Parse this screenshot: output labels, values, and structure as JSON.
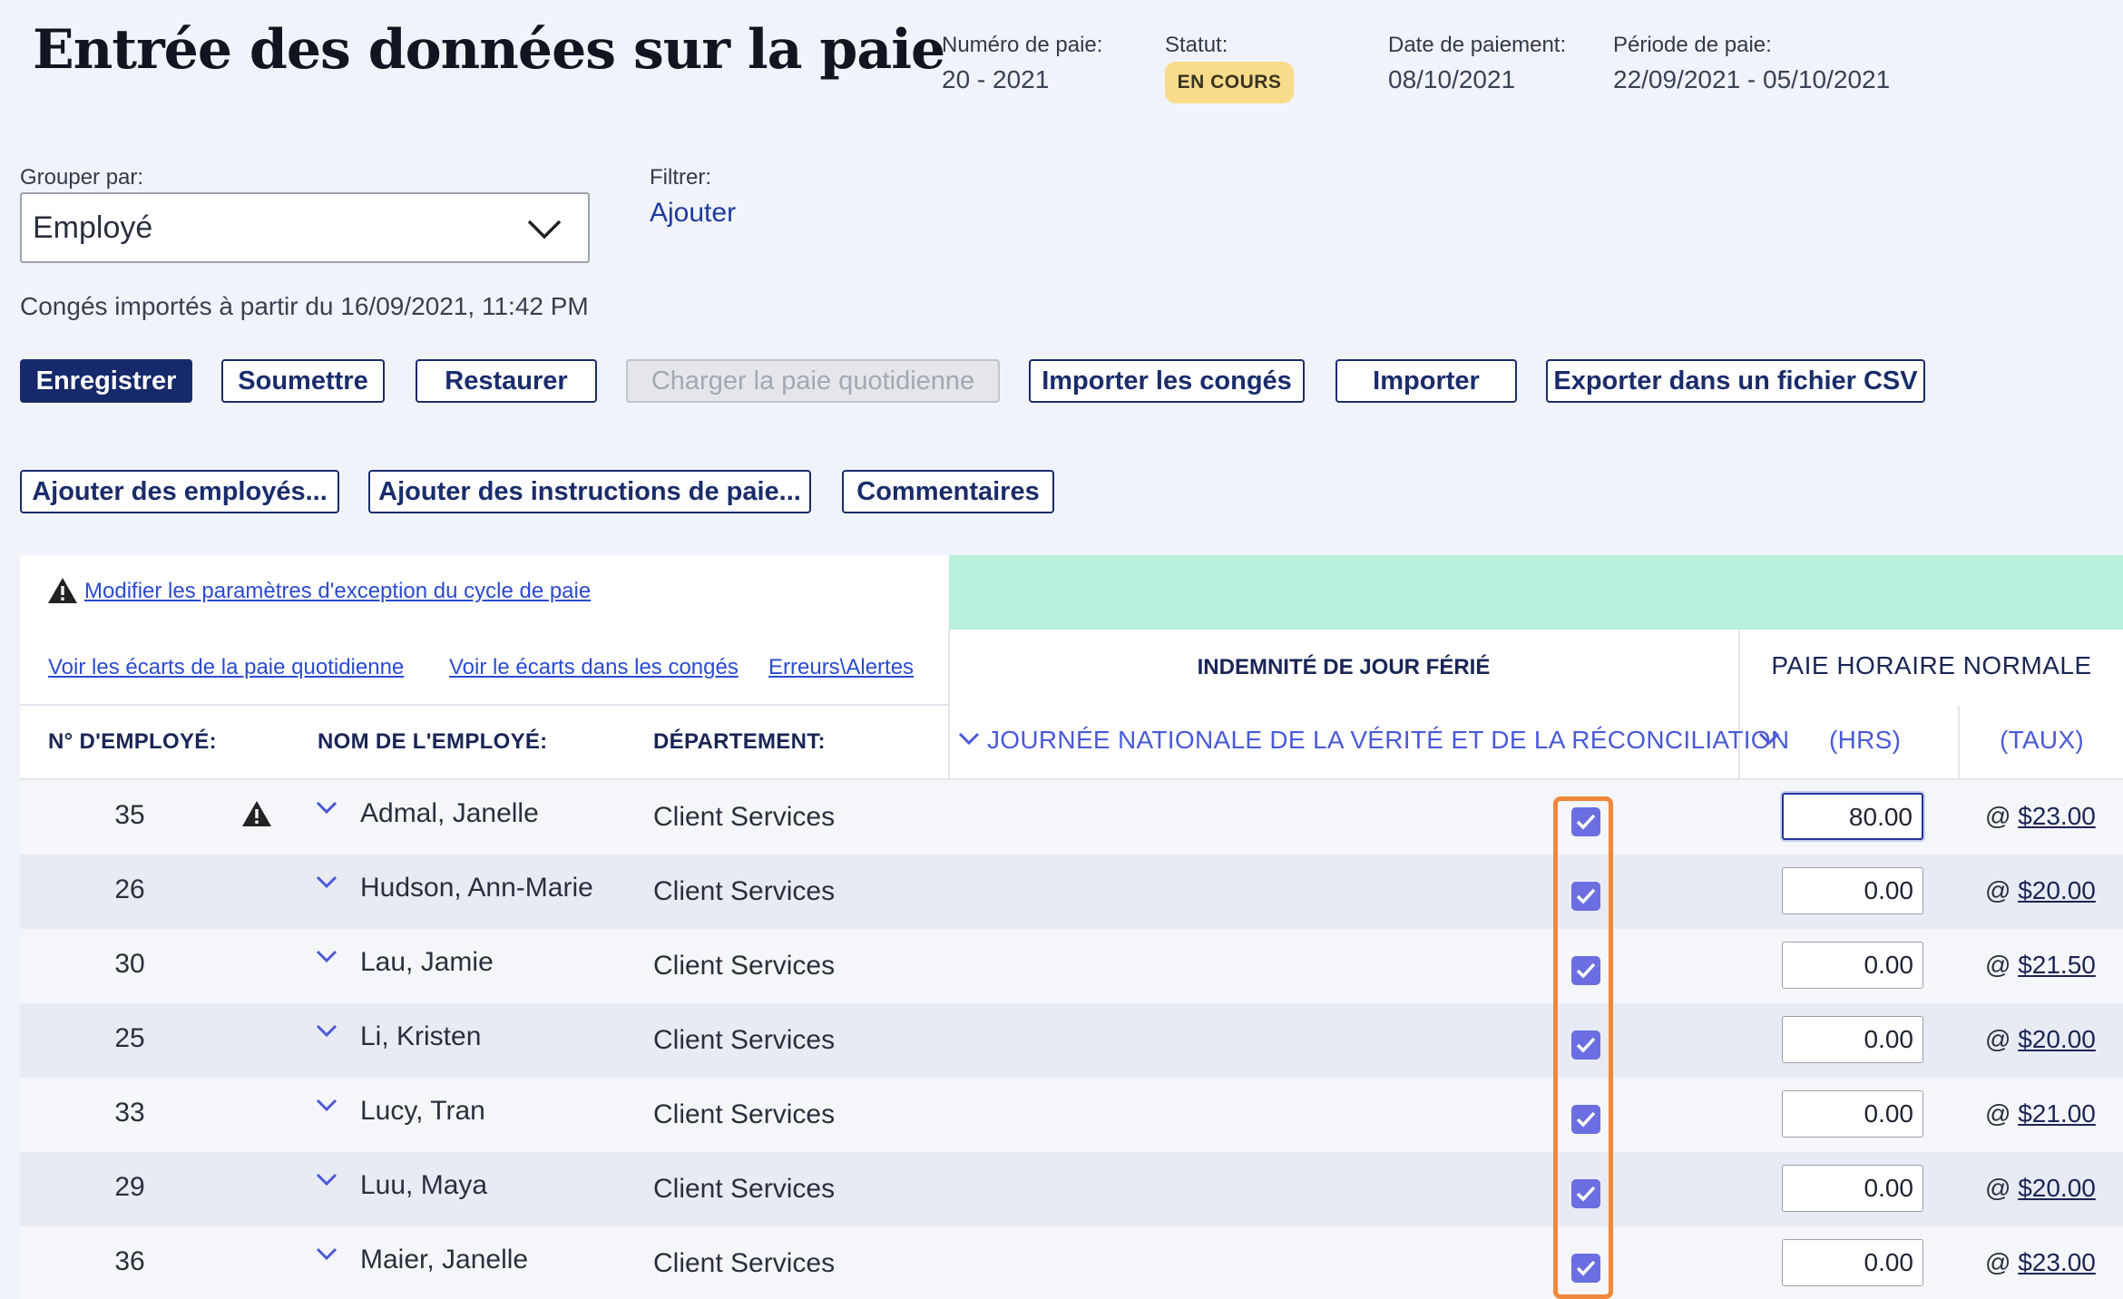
{
  "header": {
    "title": "Entrée des données sur la paie",
    "pay_number": {
      "label": "Numéro de paie:",
      "value": "20 - 2021"
    },
    "status": {
      "label": "Statut:",
      "value": "EN COURS"
    },
    "payment_date": {
      "label": "Date de paiement:",
      "value": "08/10/2021"
    },
    "pay_period": {
      "label": "Période de paie:",
      "value": "22/09/2021 - 05/10/2021"
    }
  },
  "group_by": {
    "label": "Grouper par:",
    "value": "Employé"
  },
  "filter": {
    "label": "Filtrer:",
    "add_link": "Ajouter"
  },
  "import_note": "Congés importés à partir du 16/09/2021, 11:42 PM",
  "toolbar1": {
    "save": "Enregistrer",
    "submit": "Soumettre",
    "restore": "Restaurer",
    "load_daily": "Charger la paie quotidienne",
    "import_leave": "Importer les congés",
    "import": "Importer",
    "export_csv": "Exporter dans un fichier CSV"
  },
  "toolbar2": {
    "add_employees": "Ajouter des employés...",
    "add_instructions": "Ajouter des instructions de paie...",
    "comments": "Commentaires"
  },
  "links": {
    "modify_exception": "Modifier les paramètres d'exception du cycle de paie",
    "daily_gaps": "Voir les écarts de la paie quotidienne",
    "leave_gaps": "Voir le écarts dans les congés",
    "errors": "Erreurs\\Alertes"
  },
  "columns": {
    "emp_no": "N° D'EMPLOYÉ:",
    "emp_name": "NOM DE L'EMPLOYÉ:",
    "department": "DÉPARTEMENT:",
    "holiday_group": "INDEMNITÉ DE JOUR FÉRIÉ",
    "holiday_sub": "JOURNÉE NATIONALE DE LA VÉRITÉ ET DE LA RÉCONCILIATION",
    "regular_group": "PAIE HORAIRE NORMALE",
    "hrs": "(HRS)",
    "rate": "(TAUX)"
  },
  "rows": [
    {
      "id": "35",
      "name": "Admal, Janelle",
      "dept": "Client Services",
      "hrs": "80.00",
      "rate": "$23.00",
      "warning": true
    },
    {
      "id": "26",
      "name": "Hudson, Ann-Marie",
      "dept": "Client Services",
      "hrs": "0.00",
      "rate": "$20.00"
    },
    {
      "id": "30",
      "name": "Lau, Jamie",
      "dept": "Client Services",
      "hrs": "0.00",
      "rate": "$21.50"
    },
    {
      "id": "25",
      "name": "Li, Kristen",
      "dept": "Client Services",
      "hrs": "0.00",
      "rate": "$20.00"
    },
    {
      "id": "33",
      "name": "Lucy, Tran",
      "dept": "Client Services",
      "hrs": "0.00",
      "rate": "$21.00"
    },
    {
      "id": "29",
      "name": "Luu, Maya",
      "dept": "Client Services",
      "hrs": "0.00",
      "rate": "$20.00"
    },
    {
      "id": "36",
      "name": "Maier, Janelle",
      "dept": "Client Services",
      "hrs": "0.00",
      "rate": "$23.00"
    }
  ],
  "at_symbol": "@",
  "colors": {
    "primary": "#15296b",
    "accent_check": "#6a6ee0",
    "mint": "#b8f0dc",
    "highlight": "#f0883a",
    "badge": "#f8dc8c"
  }
}
